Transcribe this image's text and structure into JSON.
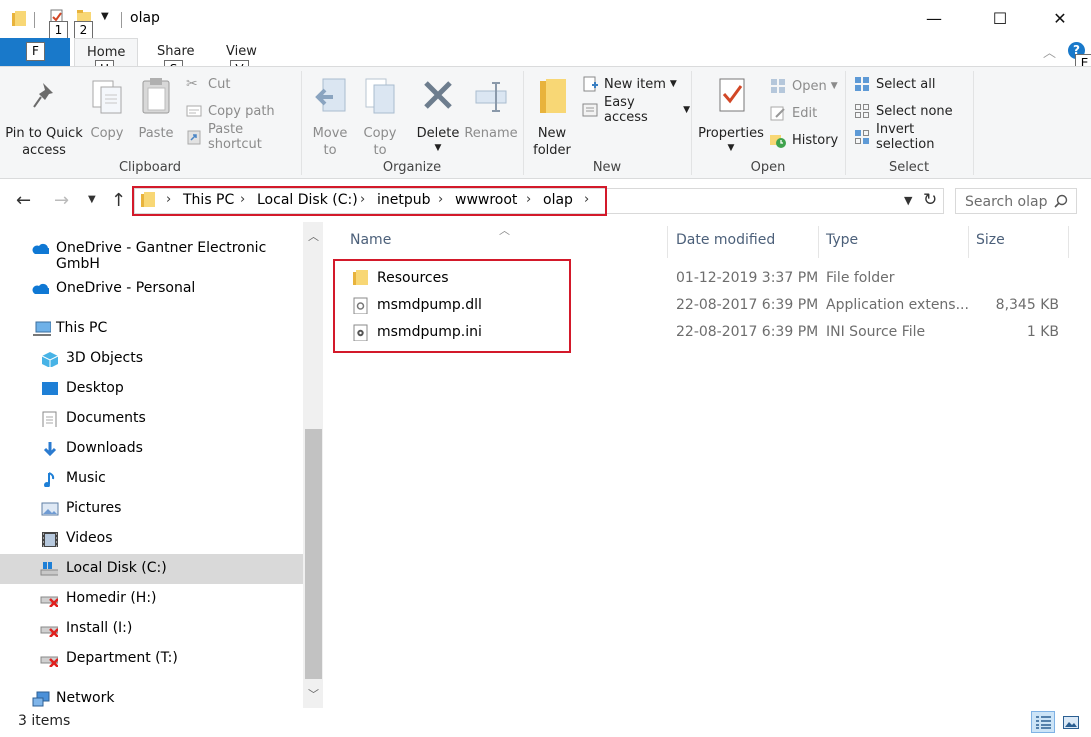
{
  "window": {
    "title": "olap",
    "controls": {
      "minimize": "—",
      "maximize": "☐",
      "close": "✕"
    }
  },
  "qat": {
    "keytips": [
      "1",
      "2"
    ]
  },
  "ribbon": {
    "tabs": [
      {
        "label": "Home",
        "keytip": "H",
        "active": true
      },
      {
        "label": "Share",
        "keytip": "S"
      },
      {
        "label": "View",
        "keytip": "V"
      }
    ],
    "file_tab_keytip": "F",
    "help_keytip": "E",
    "clipboard": {
      "label": "Clipboard",
      "pin": "Pin to Quick access",
      "pin_line1": "Pin to Quick",
      "pin_line2": "access",
      "copy": "Copy",
      "paste": "Paste",
      "cut": "Cut",
      "copy_path": "Copy path",
      "paste_shortcut": "Paste shortcut"
    },
    "organize": {
      "label": "Organize",
      "move_line1": "Move",
      "move_line2": "to",
      "copy_line1": "Copy",
      "copy_line2": "to",
      "delete": "Delete",
      "rename": "Rename"
    },
    "new": {
      "label": "New",
      "new_folder_line1": "New",
      "new_folder_line2": "folder",
      "new_item": "New item",
      "easy_access": "Easy access"
    },
    "open": {
      "label": "Open",
      "properties": "Properties",
      "open": "Open",
      "edit": "Edit",
      "history": "History"
    },
    "select": {
      "label": "Select",
      "select_all": "Select all",
      "select_none": "Select none",
      "invert_selection": "Invert selection"
    }
  },
  "address": {
    "breadcrumbs": [
      "This PC",
      "Local Disk (C:)",
      "inetpub",
      "wwwroot",
      "olap"
    ],
    "search_placeholder": "Search olap"
  },
  "navpane": {
    "items": [
      {
        "label": "OneDrive - Gantner Electronic GmbH",
        "icon": "cloud-icon",
        "indent": 0
      },
      {
        "label": "OneDrive - Personal",
        "icon": "cloud-icon",
        "indent": 0
      },
      {
        "label": "This PC",
        "icon": "computer-icon",
        "indent": 0
      },
      {
        "label": "3D Objects",
        "icon": "cube-icon",
        "indent": 1
      },
      {
        "label": "Desktop",
        "icon": "desktop-icon",
        "indent": 1
      },
      {
        "label": "Documents",
        "icon": "document-icon",
        "indent": 1
      },
      {
        "label": "Downloads",
        "icon": "download-icon",
        "indent": 1
      },
      {
        "label": "Music",
        "icon": "music-icon",
        "indent": 1
      },
      {
        "label": "Pictures",
        "icon": "pictures-icon",
        "indent": 1
      },
      {
        "label": "Videos",
        "icon": "video-icon",
        "indent": 1
      },
      {
        "label": "Local Disk (C:)",
        "icon": "drive-icon",
        "indent": 1,
        "selected": true
      },
      {
        "label": "Homedir (H:)",
        "icon": "disconnected-drive-icon",
        "indent": 1
      },
      {
        "label": "Install (I:)",
        "icon": "disconnected-drive-icon",
        "indent": 1
      },
      {
        "label": "Department (T:)",
        "icon": "disconnected-drive-icon",
        "indent": 1
      },
      {
        "label": "Network",
        "icon": "network-icon",
        "indent": 0
      }
    ]
  },
  "filelist": {
    "columns": [
      "Name",
      "Date modified",
      "Type",
      "Size"
    ],
    "rows": [
      {
        "name": "Resources",
        "date": "01-12-2019 3:37 PM",
        "type": "File folder",
        "size": "",
        "icon": "folder-icon"
      },
      {
        "name": "msmdpump.dll",
        "date": "22-08-2017 6:39 PM",
        "type": "Application extens...",
        "size": "8,345 KB",
        "icon": "dll-file-icon"
      },
      {
        "name": "msmdpump.ini",
        "date": "22-08-2017 6:39 PM",
        "type": "INI Source File",
        "size": "1 KB",
        "icon": "ini-file-icon"
      }
    ]
  },
  "status": {
    "item_count": "3 items"
  },
  "colors": {
    "accent": "#1979ca",
    "highlight": "#d3192a",
    "selected_nav": "#d9d9d9"
  }
}
